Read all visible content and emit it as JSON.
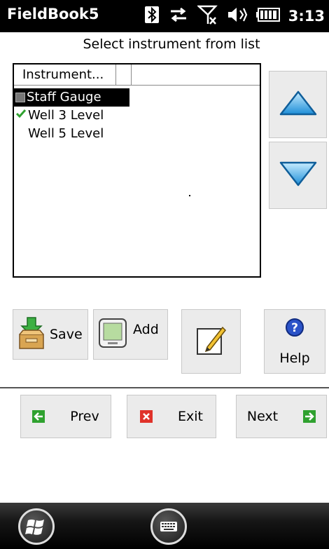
{
  "statusbar": {
    "app_title": "FieldBook5",
    "time": "3:13",
    "icons": [
      "bluetooth-icon",
      "data-transfer-icon",
      "no-signal-icon",
      "volume-icon",
      "battery-icon"
    ]
  },
  "subtitle": "Select instrument from list",
  "list": {
    "column_header": "Instrument...",
    "rows": [
      {
        "label": "Staff Gauge",
        "selected": true,
        "checked": false
      },
      {
        "label": "Well 3 Level",
        "selected": false,
        "checked": true
      },
      {
        "label": "Well 5 Level",
        "selected": false,
        "checked": false
      }
    ]
  },
  "buttons": {
    "save": "Save",
    "add": "Add",
    "help": "Help",
    "prev": "Prev",
    "exit": "Exit",
    "next": "Next"
  },
  "colors": {
    "arrow_blue": "#3aa6e6",
    "check_green": "#2fa12f",
    "exit_red": "#e0322a",
    "help_blue": "#2b53c8"
  }
}
